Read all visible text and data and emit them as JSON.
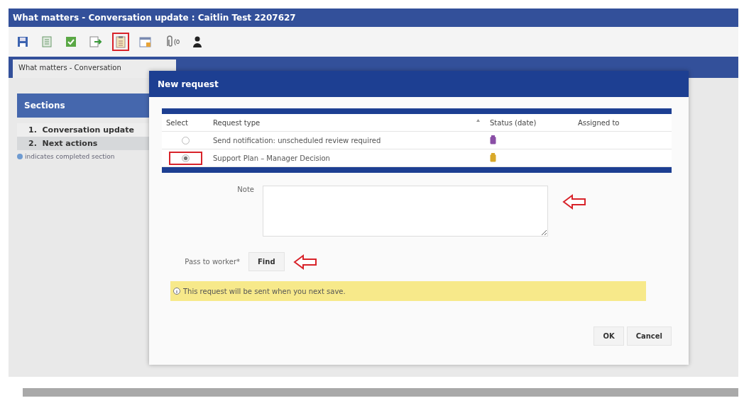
{
  "window": {
    "title": "What matters - Conversation update : Caitlin Test  2207627"
  },
  "toolbar": [
    {
      "kind": "save",
      "highlighted": false
    },
    {
      "kind": "sheet",
      "highlighted": false
    },
    {
      "kind": "check",
      "highlighted": false
    },
    {
      "kind": "export",
      "highlighted": false
    },
    {
      "kind": "clipboard",
      "highlighted": true
    },
    {
      "kind": "calendar",
      "highlighted": false
    },
    {
      "kind": "attachment",
      "highlighted": false,
      "count": "(0"
    },
    {
      "kind": "person",
      "highlighted": false
    }
  ],
  "tab": {
    "label": "What matters - Conversation"
  },
  "sections": {
    "title": "Sections",
    "items": [
      {
        "number": "1.",
        "label": "Conversation update",
        "selected": false
      },
      {
        "number": "2.",
        "label": "Next actions",
        "selected": true
      }
    ],
    "legend": "indicates completed section"
  },
  "dialog": {
    "title": "New request",
    "columns": [
      "Select",
      "Request type",
      "Status (date)",
      "Assigned to"
    ],
    "rows": [
      {
        "selected": false,
        "highlighted": false,
        "request_type": "Send notification: unscheduled review required",
        "color": "#8a4fa6"
      },
      {
        "selected": true,
        "highlighted": true,
        "request_type": "Support Plan – Manager Decision",
        "color": "#d9a92a"
      }
    ],
    "note": {
      "label": "Note",
      "annotated": true
    },
    "worker": {
      "label": "Pass to worker*",
      "button": "Find",
      "annotated": true
    },
    "info": "This request will be sent when you next save.",
    "buttons": [
      "OK",
      "Cancel"
    ]
  }
}
